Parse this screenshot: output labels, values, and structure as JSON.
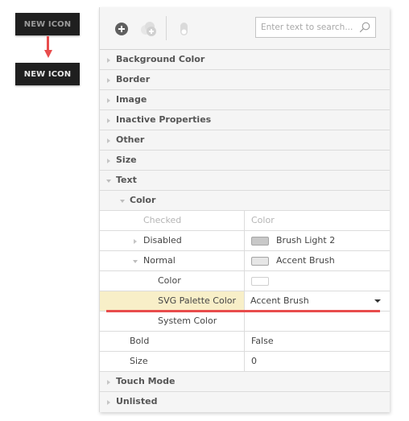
{
  "preview": {
    "before_label": "NEW ICON",
    "after_label": "NEW ICON",
    "arrow_color": "#e84c4c"
  },
  "toolbar": {
    "icons": [
      "add-circle-icon",
      "add-background-icon",
      "toggle-icon"
    ],
    "search_placeholder": "Enter text to search...",
    "search_value": ""
  },
  "categories_top": [
    {
      "label": "Background Color",
      "expanded": false
    },
    {
      "label": "Border",
      "expanded": false
    },
    {
      "label": "Image",
      "expanded": false
    },
    {
      "label": "Inactive Properties",
      "expanded": false
    },
    {
      "label": "Other",
      "expanded": false
    },
    {
      "label": "Size",
      "expanded": false
    }
  ],
  "text_category": {
    "label": "Text",
    "expanded": true,
    "color_group": {
      "label": "Color",
      "expanded": true,
      "checked": {
        "label": "Checked",
        "value": "Color"
      },
      "disabled": {
        "label": "Disabled",
        "value": "Brush Light 2",
        "swatch": "#c8c8c8"
      },
      "normal": {
        "label": "Normal",
        "value": "Accent Brush",
        "swatch": "#e6e6e6",
        "children": {
          "color": {
            "label": "Color",
            "swatch": "#ffffff"
          },
          "svg_palette_color": {
            "label": "SVG Palette Color",
            "value": "Accent Brush",
            "highlight": "#f8efc8",
            "underline": "#e84c4c"
          },
          "system_color": {
            "label": "System Color",
            "value": ""
          }
        }
      }
    },
    "bold": {
      "label": "Bold",
      "value": "False"
    },
    "size": {
      "label": "Size",
      "value": "0"
    }
  },
  "categories_bottom": [
    {
      "label": "Touch Mode",
      "expanded": false
    },
    {
      "label": "Unlisted",
      "expanded": false
    }
  ]
}
